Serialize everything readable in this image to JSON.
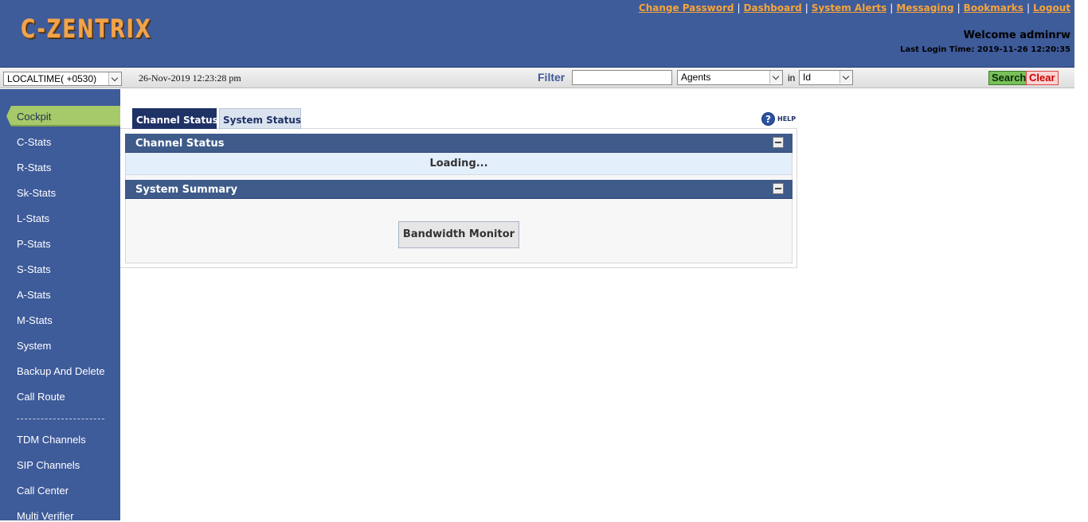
{
  "header": {
    "logo": "C-ZENTRIX",
    "links": [
      "Change Password",
      "Dashboard",
      "System Alerts",
      "Messaging",
      "Bookmarks",
      "Logout"
    ],
    "welcome": "Welcome adminrw",
    "last_login": "Last Login Time: 2019-11-26 12:20:35"
  },
  "toolbar": {
    "timezone_value": "LOCALTIME( +0530)",
    "datetime": "26-Nov-2019 12:23:28 pm",
    "filter_label": "Filter",
    "filter_value": "",
    "category_value": "Agents",
    "in_label": "in",
    "field_value": "Id",
    "search_label": "Search",
    "clear_label": "Clear"
  },
  "sidebar": {
    "active": "Cockpit",
    "items": [
      "C-Stats",
      "R-Stats",
      "Sk-Stats",
      "L-Stats",
      "P-Stats",
      "S-Stats",
      "A-Stats",
      "M-Stats",
      "System",
      "Backup And Delete",
      "Call Route"
    ],
    "items2": [
      "TDM Channels",
      "SIP Channels",
      "Call Center",
      "Multi Verifier"
    ]
  },
  "main": {
    "tabs": [
      "Channel Status",
      "System Status"
    ],
    "help_label": "HELP",
    "channel_section_title": "Channel Status",
    "loading_text": "Loading...",
    "summary_section_title": "System Summary",
    "bandwidth_button": "Bandwidth Monitor"
  },
  "colors": {
    "header_bg": "#3e5b9a",
    "link": "#f5a43a",
    "active_nav": "#a6c96a",
    "section_head": "#3e5b8a"
  }
}
